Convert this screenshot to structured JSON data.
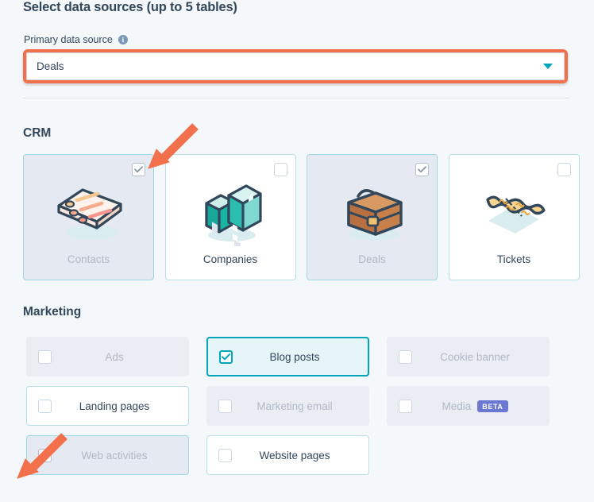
{
  "header": {
    "title": "Select data sources (up to 5 tables)",
    "field_label": "Primary data source",
    "info_icon": "info-icon"
  },
  "primary_source": {
    "value": "Deals",
    "caret_icon": "chevron-down-icon",
    "highlight_color": "#f2714c"
  },
  "crm": {
    "title": "CRM",
    "cards": [
      {
        "label": "Contacts",
        "icon": "contacts-list-icon",
        "checked": true,
        "disabled": true
      },
      {
        "label": "Companies",
        "icon": "office-buildings-icon",
        "checked": false,
        "disabled": false
      },
      {
        "label": "Deals",
        "icon": "briefcase-icon",
        "checked": true,
        "disabled": true
      },
      {
        "label": "Tickets",
        "icon": "ticket-icon",
        "checked": false,
        "disabled": false
      }
    ]
  },
  "marketing": {
    "title": "Marketing",
    "items": [
      {
        "label": "Ads",
        "checked": false,
        "disabled": true,
        "badge": ""
      },
      {
        "label": "Blog posts",
        "checked": true,
        "disabled": false,
        "badge": ""
      },
      {
        "label": "Cookie banner",
        "checked": false,
        "disabled": true,
        "badge": ""
      },
      {
        "label": "Landing pages",
        "checked": false,
        "disabled": false,
        "badge": ""
      },
      {
        "label": "Marketing email",
        "checked": false,
        "disabled": true,
        "badge": ""
      },
      {
        "label": "Media",
        "checked": false,
        "disabled": true,
        "badge": "BETA"
      },
      {
        "label": "Web activities",
        "checked": true,
        "disabled": true,
        "badge": ""
      },
      {
        "label": "Website pages",
        "checked": false,
        "disabled": false,
        "badge": ""
      }
    ]
  },
  "annotations": {
    "arrow_color": "#f2714c",
    "arrows": [
      {
        "points_to": "Contacts checkbox"
      },
      {
        "points_to": "Web activities checkbox"
      }
    ]
  },
  "colors": {
    "background": "#f5f8fa",
    "text": "#33475b",
    "accent_teal": "#00a4bd",
    "accent_orange": "#f2714c",
    "badge_purple": "#6a78d1",
    "disabled_text": "#b0b9c6"
  }
}
